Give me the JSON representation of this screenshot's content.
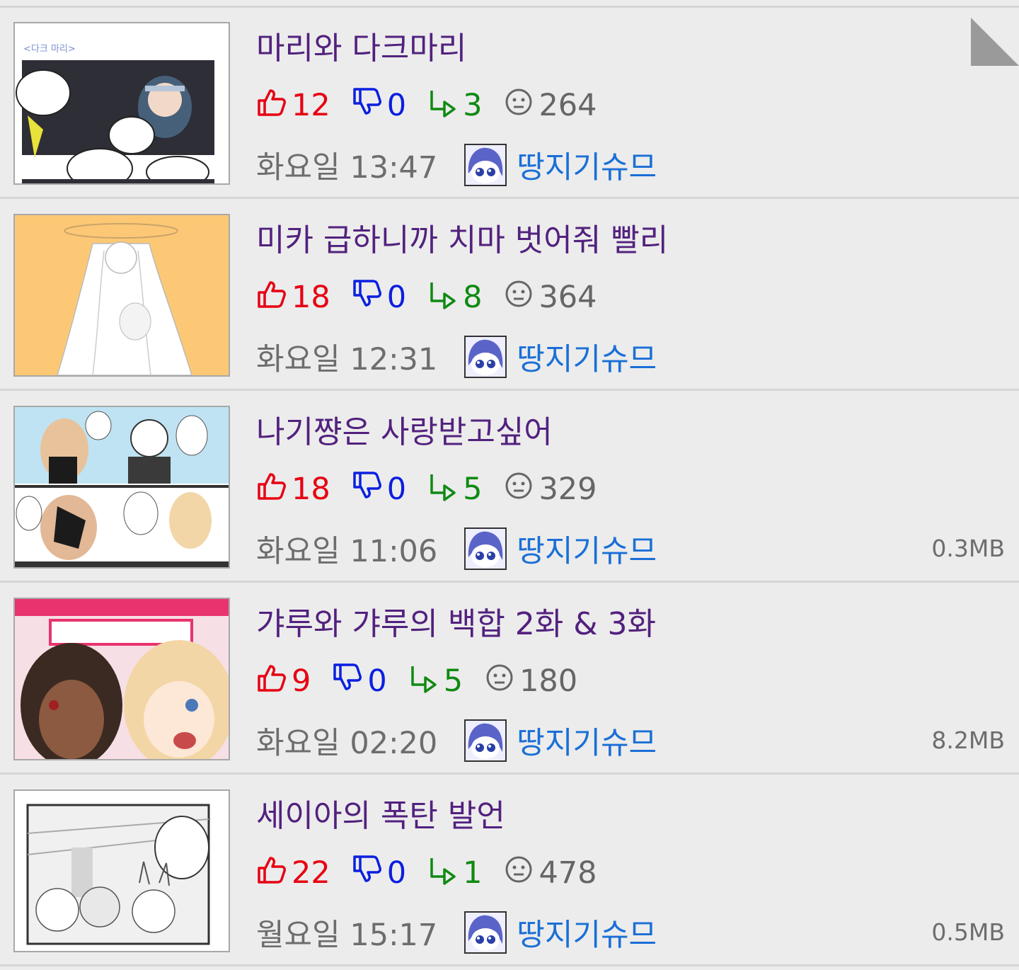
{
  "colors": {
    "title": "#52217e",
    "likes": "#e60012",
    "dislikes": "#0b1fe0",
    "comments": "#0f8a12",
    "views": "#666666",
    "author": "#1a6fd6",
    "background": "#ececec"
  },
  "icons": {
    "like": "thumbs-up-icon",
    "dislike": "thumbs-down-icon",
    "comment": "reply-arrow-icon",
    "view": "face-icon"
  },
  "posts": [
    {
      "title": "마리와 다크마리",
      "likes": "12",
      "dislikes": "0",
      "comments": "3",
      "views": "264",
      "time": "화요일 13:47",
      "author": "땅지기슈므",
      "size": ""
    },
    {
      "title": "미카 급하니까 치마 벗어줘 빨리",
      "likes": "18",
      "dislikes": "0",
      "comments": "8",
      "views": "364",
      "time": "화요일 12:31",
      "author": "땅지기슈므",
      "size": ""
    },
    {
      "title": "나기쨩은 사랑받고싶어",
      "likes": "18",
      "dislikes": "0",
      "comments": "5",
      "views": "329",
      "time": "화요일 11:06",
      "author": "땅지기슈므",
      "size": "0.3MB"
    },
    {
      "title": "갸루와 갸루의 백합 2화 & 3화",
      "likes": "9",
      "dislikes": "0",
      "comments": "5",
      "views": "180",
      "time": "화요일 02:20",
      "author": "땅지기슈므",
      "size": "8.2MB"
    },
    {
      "title": "세이아의 폭탄 발언",
      "likes": "22",
      "dislikes": "0",
      "comments": "1",
      "views": "478",
      "time": "월요일 15:17",
      "author": "땅지기슈므",
      "size": "0.5MB"
    }
  ]
}
